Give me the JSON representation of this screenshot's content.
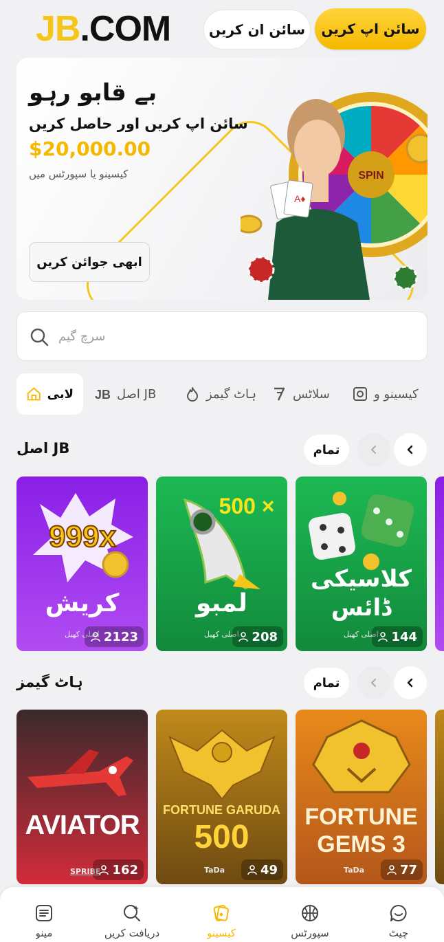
{
  "header": {
    "logo_jb": "JB",
    "logo_com": ".COM",
    "login_label": "سائن ان کریں",
    "signup_label": "سائن اپ کریں"
  },
  "banner": {
    "title": "بے قابو رہو",
    "subtitle": "سائن اپ کریں اور حاصل کریں",
    "amount": "$20,000.00",
    "note": "کیسینو یا سپورٹس میں",
    "join_label": "ابھی جوائن کریں"
  },
  "search": {
    "placeholder": "سرچ گیم"
  },
  "tabs": [
    {
      "label": "لابی",
      "icon": "home-icon",
      "active": true
    },
    {
      "label": "اصل JB",
      "icon": "jb-icon"
    },
    {
      "label": "ہاٹ گیمز",
      "icon": "fire-icon"
    },
    {
      "label": "سلاٹس",
      "icon": "seven-icon"
    },
    {
      "label": "کیسینو و",
      "icon": "casino-icon"
    }
  ],
  "sections": [
    {
      "title": "اصل JB",
      "all_label": "تمام",
      "cards": [
        {
          "title": "کریش",
          "badge": "999x",
          "maker": "اصلی کھیل",
          "players": "2123",
          "color": "#8a1fe6"
        },
        {
          "title": "لمبو",
          "badge": "500 ×",
          "maker": "اصلی کھیل",
          "players": "208",
          "color": "#1db954"
        },
        {
          "title": "کلاسیکی ڈائس",
          "maker": "اصلی کھیل",
          "players": "144",
          "color": "#1db954"
        }
      ]
    },
    {
      "title": "ہاٹ گیمز",
      "all_label": "تمام",
      "cards": [
        {
          "title": "AVIATOR",
          "maker": "SPRIBE",
          "players": "162",
          "color": "#d22b3a"
        },
        {
          "title": "FORTUNE GARUDA 500",
          "title_line1": "FORTUNE GARUDA",
          "title_line2": "500",
          "maker": "TaDa",
          "players": "49",
          "color": "#c08a1a"
        },
        {
          "title": "FORTUNE GEMS 3",
          "title_line1": "FORTUNE",
          "title_line2": "GEMS 3",
          "maker": "TaDa",
          "players": "77",
          "color": "#e88a1a"
        }
      ]
    }
  ],
  "bottom_nav": [
    {
      "label": "مینو",
      "icon": "menu-icon"
    },
    {
      "label": "دریافت کریں",
      "icon": "explore-icon"
    },
    {
      "label": "کیسینو",
      "icon": "casino-icon",
      "active": true
    },
    {
      "label": "سپورٹس",
      "icon": "basketball-icon"
    },
    {
      "label": "چیٹ",
      "icon": "chat-icon"
    }
  ],
  "colors": {
    "brand": "#f5c518",
    "accent": "#f5b800"
  }
}
